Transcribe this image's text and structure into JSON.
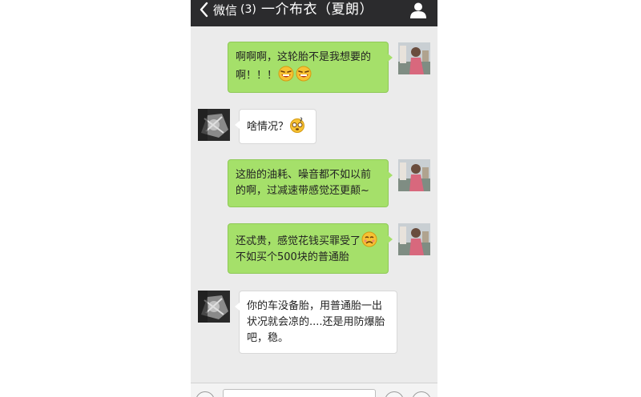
{
  "topbar": {
    "back_label": "微信",
    "back_count": "(3)",
    "title": "一介布衣（夏朗）"
  },
  "messages": [
    {
      "from": "me",
      "text": "啊啊啊，这轮胎不是我想要的啊！！！",
      "emoji_after": [
        "laugh-emoji",
        "laugh-emoji"
      ]
    },
    {
      "from": "other",
      "text": "啥情况？",
      "emoji_after": [
        "dizzy-emoji"
      ]
    },
    {
      "from": "me",
      "text": "这胎的油耗、噪音都不如以前的啊，过减速带感觉还更颠~",
      "emoji_after": []
    },
    {
      "from": "me",
      "text_before_emoji": "还忒贵，感觉花钱买罪受了",
      "emoji": "sad-emoji",
      "text_after_emoji": "不如买个500块的普通胎"
    },
    {
      "from": "other",
      "text": "你的车没备胎，用普通胎一出状况就会凉的....还是用防爆胎吧，稳。",
      "emoji_after": []
    }
  ],
  "colors": {
    "topbar_bg": "#2b2b2d",
    "chat_bg": "#ebebeb",
    "outgoing_bubble": "#a5e06a",
    "incoming_bubble": "#ffffff"
  }
}
